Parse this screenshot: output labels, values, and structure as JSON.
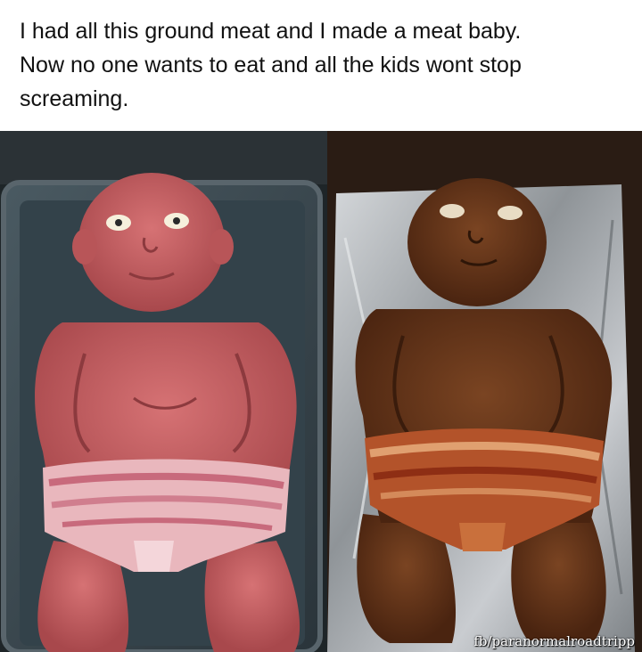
{
  "caption": {
    "line1": "I had all this ground meat and I made a meat baby.",
    "line2": "Now no one wants to eat and all the kids wont stop",
    "line3": "screaming."
  },
  "photos": {
    "left": {
      "subject": "raw ground-meat baby in a metal baking tray with a bacon diaper",
      "colors": {
        "meat": "#c45a5c",
        "bacon": "#e6a8b0",
        "tray": "#3a4850"
      }
    },
    "right": {
      "subject": "cooked meatloaf baby on aluminum foil with a crispy bacon diaper",
      "colors": {
        "meat": "#6b3a1c",
        "bacon": "#b04a24",
        "foil": "#b8bcc0"
      }
    }
  },
  "watermark": "fb/paranormalroadtripp"
}
